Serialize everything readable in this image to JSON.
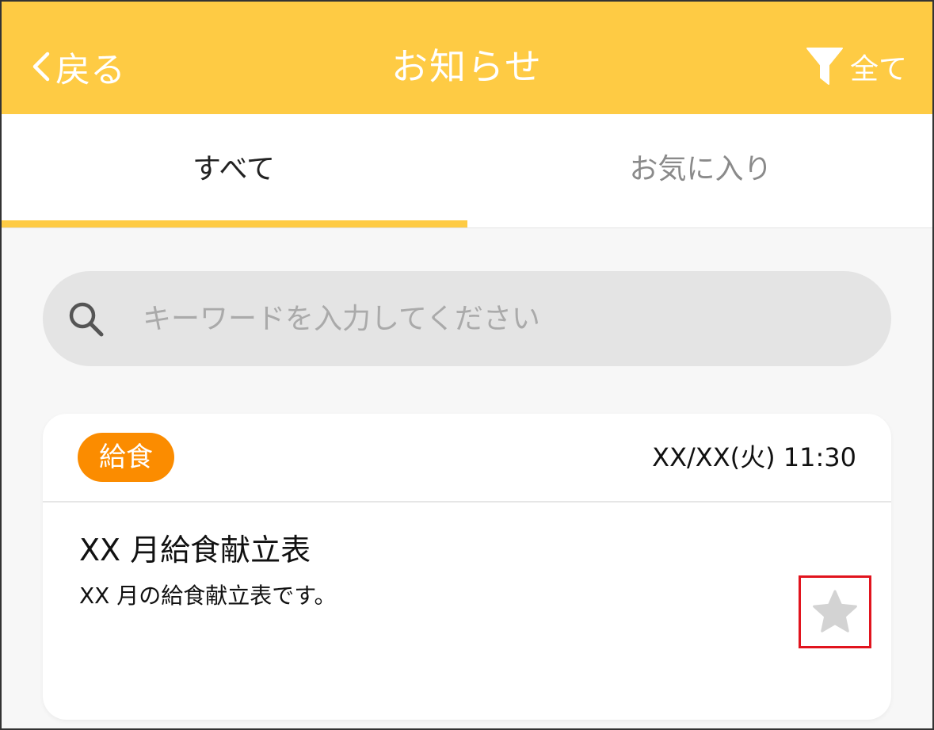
{
  "header": {
    "back_label": "戻る",
    "title": "お知らせ",
    "filter_label": "全て",
    "background_color": "#fecb44"
  },
  "tabs": [
    {
      "label": "すべて",
      "active": true
    },
    {
      "label": "お気に入り",
      "active": false
    }
  ],
  "search": {
    "placeholder": "キーワードを入力してください",
    "value": ""
  },
  "notices": [
    {
      "category": "給食",
      "category_color": "#fb8c00",
      "datetime": "XX/XX(火)  11:30",
      "title": "XX 月給食献立表",
      "description": "XX 月の給食献立表です。",
      "favorite": false
    }
  ],
  "icons": {
    "back": "chevron-left-icon",
    "filter": "filter-icon",
    "search": "search-icon",
    "favorite": "star-icon"
  },
  "highlight_color": "#e1141e"
}
